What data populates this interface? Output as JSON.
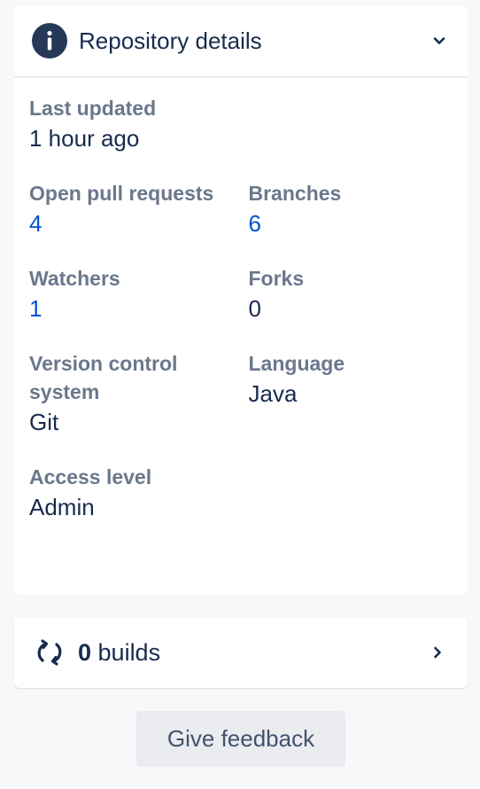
{
  "details": {
    "title": "Repository details",
    "icon": "info-icon",
    "toggle_icon": "chevron-down-icon",
    "last_updated": {
      "label": "Last updated",
      "value": "1 hour ago"
    },
    "open_pull_requests": {
      "label": "Open pull requests",
      "value": "4"
    },
    "branches": {
      "label": "Branches",
      "value": "6"
    },
    "watchers": {
      "label": "Watchers",
      "value": "1"
    },
    "forks": {
      "label": "Forks",
      "value": "0"
    },
    "vcs": {
      "label": "Version control system",
      "value": "Git"
    },
    "language": {
      "label": "Language",
      "value": "Java"
    },
    "access_level": {
      "label": "Access level",
      "value": "Admin"
    }
  },
  "builds": {
    "icon": "sync-icon",
    "count": "0",
    "label": " builds",
    "chevron": "chevron-right-icon"
  },
  "feedback": {
    "label": "Give feedback"
  },
  "colors": {
    "link": "#0052cc",
    "label": "#6b778c",
    "text": "#172b4d",
    "icon_bg": "#253858",
    "background": "#f7f8f9"
  }
}
